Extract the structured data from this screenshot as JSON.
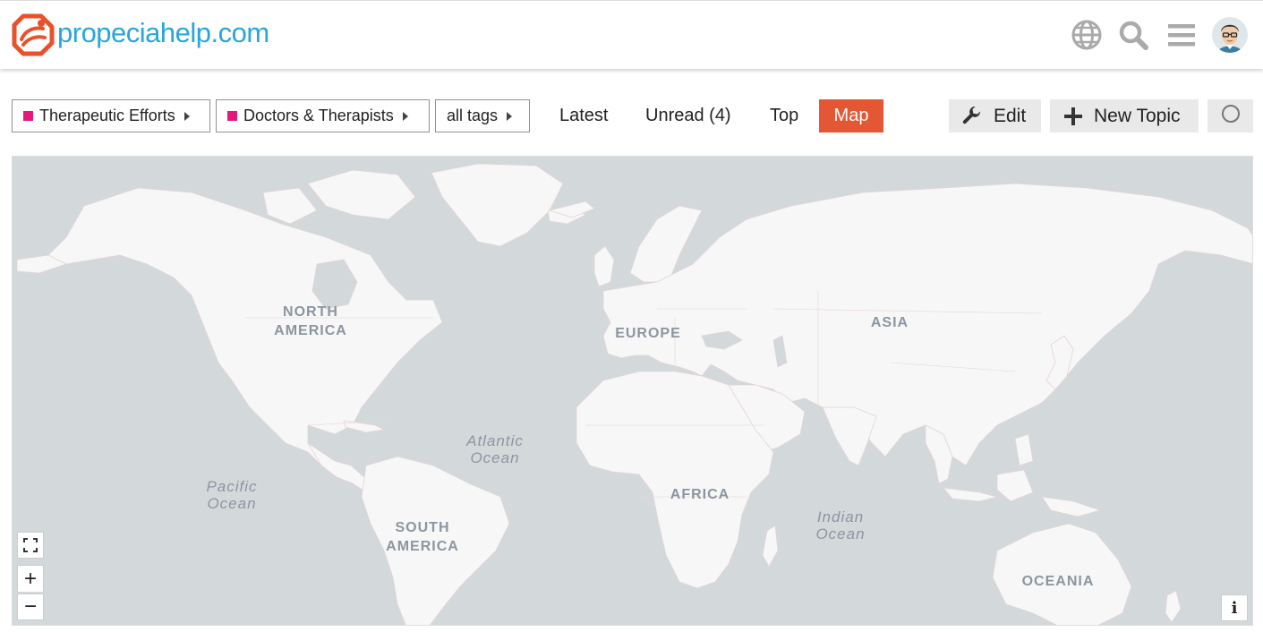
{
  "site": {
    "logo_text": "propeciahelp.com"
  },
  "header": {
    "icons": [
      "globe-icon",
      "search-icon",
      "hamburger-icon"
    ],
    "avatar": "user-avatar"
  },
  "nav": {
    "category_dropdown": {
      "label": "Therapeutic Efforts",
      "color": "#e5197b"
    },
    "subcategory_dropdown": {
      "label": "Doctors & Therapists",
      "color": "#e5197b"
    },
    "tags_dropdown": {
      "label": "all tags"
    },
    "tabs": [
      {
        "label": "Latest",
        "active": false
      },
      {
        "label": "Unread (4)",
        "active": false
      },
      {
        "label": "Top",
        "active": false
      },
      {
        "label": "Map",
        "active": true
      }
    ],
    "edit_button": {
      "label": "Edit",
      "icon": "wrench-icon"
    },
    "new_topic_button": {
      "label": "New Topic",
      "icon": "plus-icon"
    },
    "notification_button": {
      "icon": "circle-icon"
    }
  },
  "map": {
    "continents": [
      {
        "id": "north-america",
        "label": "NORTH\nAMERICA"
      },
      {
        "id": "europe",
        "label": "EUROPE"
      },
      {
        "id": "asia",
        "label": "ASIA"
      },
      {
        "id": "africa",
        "label": "AFRICA"
      },
      {
        "id": "south-america",
        "label": "SOUTH\nAMERICA"
      },
      {
        "id": "oceania",
        "label": "OCEANIA"
      }
    ],
    "oceans": [
      {
        "id": "atlantic",
        "label": "Atlantic\nOcean"
      },
      {
        "id": "pacific",
        "label": "Pacific\nOcean"
      },
      {
        "id": "indian",
        "label": "Indian\nOcean"
      }
    ],
    "controls": {
      "fullscreen_icon": "fullscreen-icon",
      "zoom_in": "+",
      "zoom_out": "−",
      "info": "i"
    },
    "colors": {
      "water": "#d3d8db",
      "land": "#f7f7f7",
      "accent": "#e45735",
      "logo_blue": "#2aa5dc",
      "logo_orange": "#e8512a"
    }
  }
}
